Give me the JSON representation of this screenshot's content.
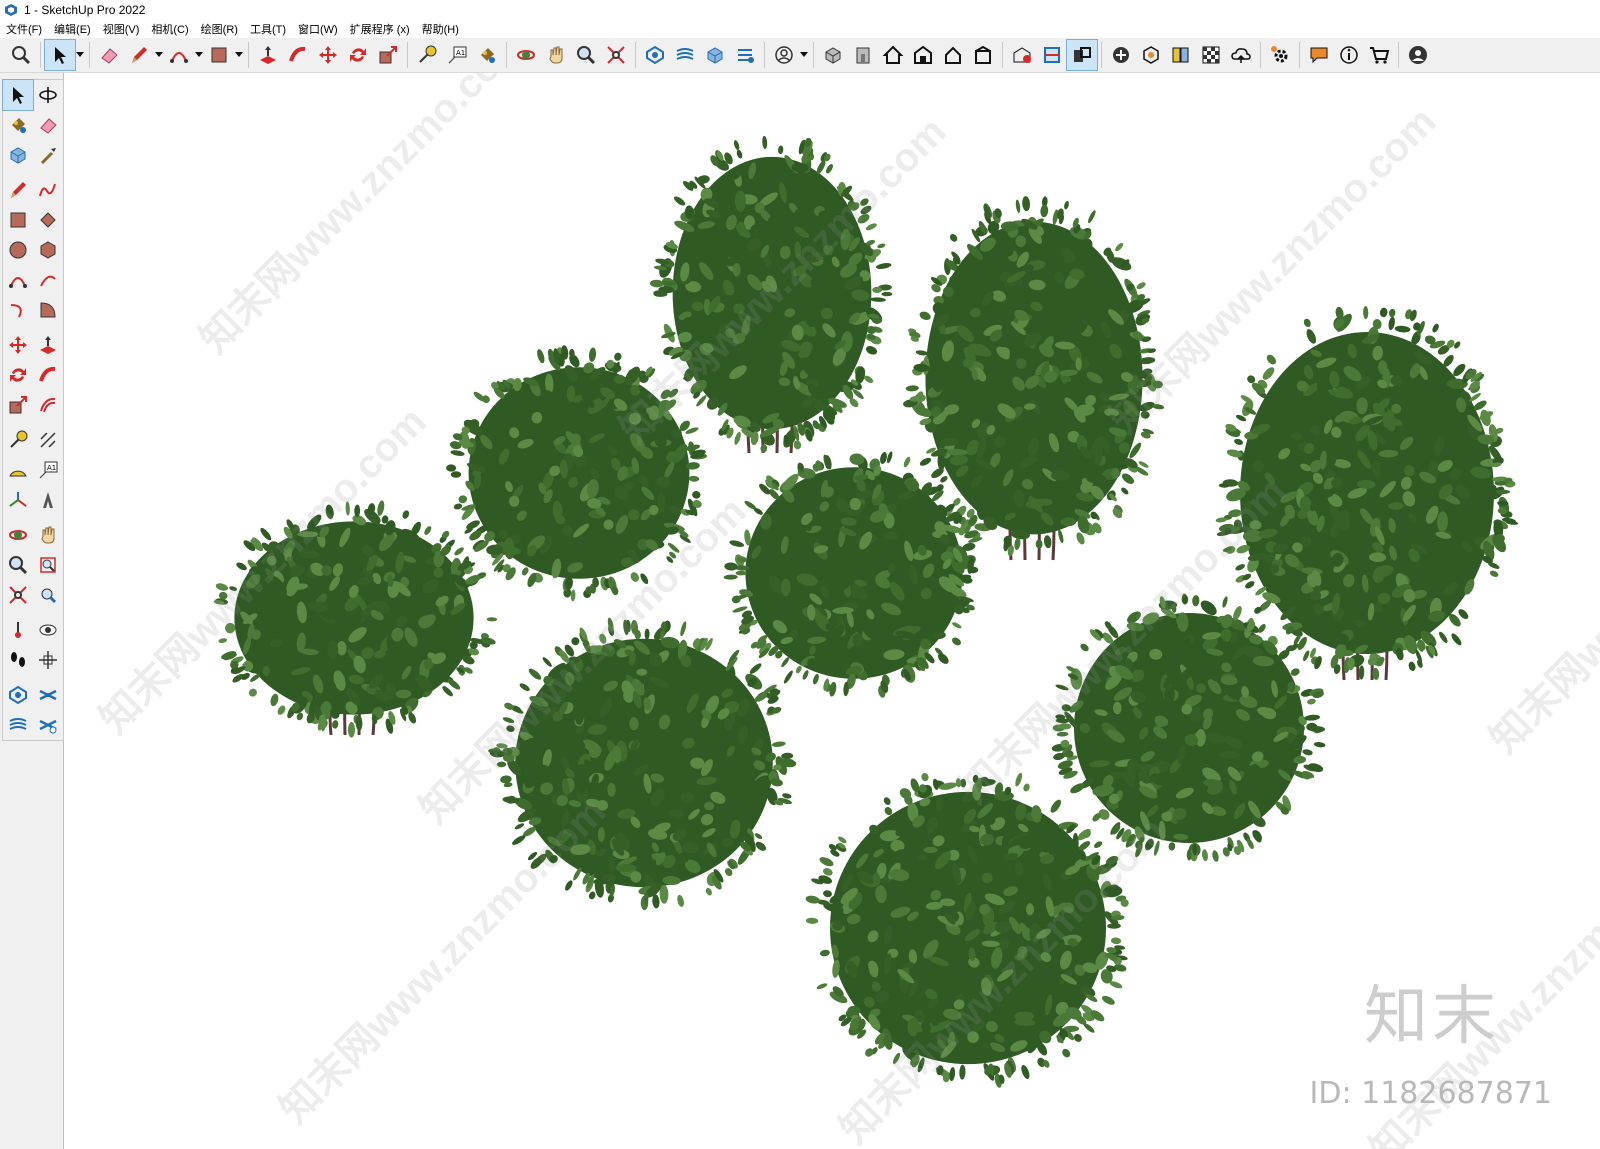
{
  "window": {
    "title": "1 - SketchUp Pro 2022"
  },
  "menu": [
    "文件(F)",
    "编辑(E)",
    "视图(V)",
    "相机(C)",
    "绘图(R)",
    "工具(T)",
    "窗口(W)",
    "扩展程序 (x)",
    "帮助(H)"
  ],
  "toolbar": {
    "buttons": [
      "zoom-extents-icon",
      "select-icon",
      "eraser-icon",
      "pencil-icon",
      "arc-icon",
      "rectangle-icon",
      "push-pull-icon",
      "follow-me-icon",
      "move-icon",
      "rotate-icon",
      "scale-icon",
      "tape-measure-icon",
      "text-icon",
      "paint-bucket-icon",
      "orbit-icon",
      "pan-icon",
      "zoom-icon",
      "zoom-window-icon",
      "sandbox-icon",
      "layers-icon",
      "component-icon",
      "outliner-icon",
      "account-icon",
      "iso-view-icon",
      "front-view-icon",
      "home-icon",
      "top-view-icon",
      "right-view-icon",
      "back-view-icon",
      "warehouse-icon",
      "section-icon",
      "section-display-icon",
      "add-icon",
      "solid-icon",
      "styles-icon",
      "texture-icon",
      "cloud-icon",
      "settings-icon",
      "chat-icon",
      "info-icon",
      "cart-icon",
      "user-icon"
    ]
  },
  "palette": {
    "tools": [
      "select-icon",
      "orbit-icon",
      "paint-bucket-icon",
      "eraser-icon",
      "component-icon",
      "dropper-icon",
      "pencil-icon",
      "freehand-icon",
      "rectangle-icon",
      "rotated-rectangle-icon",
      "circle-icon",
      "polygon-icon",
      "arc-icon",
      "two-point-arc-icon",
      "three-point-arc-icon",
      "pie-icon",
      "move-icon",
      "push-pull-icon",
      "rotate-icon",
      "follow-me-icon",
      "scale-icon",
      "offset-icon",
      "tape-measure-icon",
      "dimension-icon",
      "protractor-icon",
      "text-icon",
      "axes-icon",
      "three-d-text-icon",
      "orbit-tool-icon",
      "pan-tool-icon",
      "zoom-tool-icon",
      "zoom-window-tool-icon",
      "zoom-extents-tool-icon",
      "previous-view-icon",
      "position-camera-icon",
      "look-around-icon",
      "walk-icon",
      "section-plane-icon",
      "sandbox-a-icon",
      "sandbox-b-icon",
      "sandbox-c-icon",
      "sandbox-d-icon"
    ]
  },
  "watermark": {
    "text": "知末网www.znzmo.com",
    "logo": "知末",
    "id_label": "ID: 1182687871"
  },
  "colors": {
    "leaf_dark": "#2f5a24",
    "leaf_mid": "#3f6d2e",
    "leaf_light": "#5a8a44",
    "trunk": "#5a3a3a",
    "accent_active": "#cce4f7"
  }
}
